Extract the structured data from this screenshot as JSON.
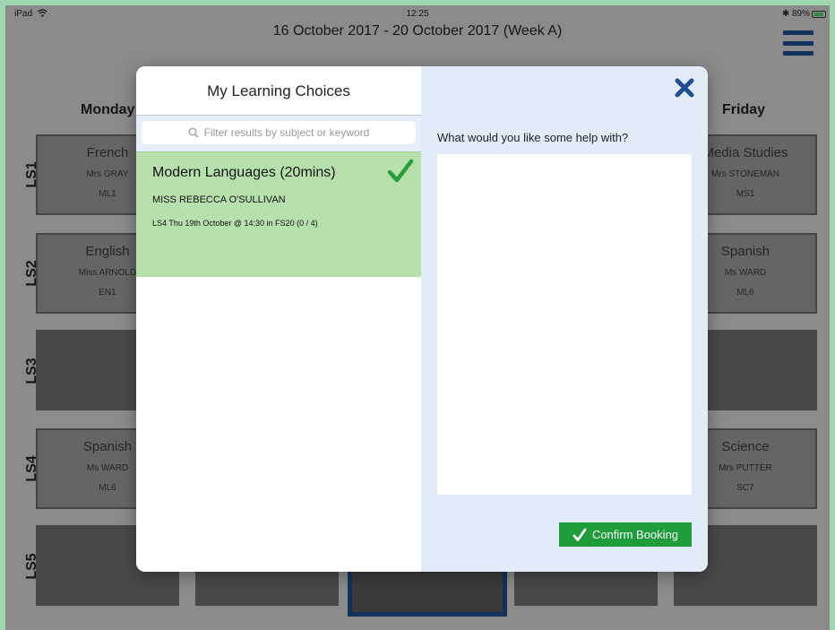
{
  "status_bar": {
    "device": "iPad",
    "time": "12:25",
    "battery_text": "89%",
    "battery_level": 0.89
  },
  "header": {
    "week_title": "16 October 2017 - 20 October 2017 (Week A)"
  },
  "days": [
    "Monday",
    "Friday"
  ],
  "rows": [
    "LS1",
    "LS2",
    "LS3",
    "LS4",
    "LS5"
  ],
  "monday_cells": [
    {
      "subject": "French",
      "teacher": "Mrs GRAY",
      "room": "ML1"
    },
    {
      "subject": "English",
      "teacher": "Miss ARNOLD",
      "room": "EN1"
    },
    {
      "subject": "",
      "teacher": "",
      "room": ""
    },
    {
      "subject": "Spanish",
      "teacher": "Ms WARD",
      "room": "ML6"
    },
    {
      "subject": "",
      "teacher": "",
      "room": ""
    }
  ],
  "friday_cells": [
    {
      "subject": "Media Studies",
      "teacher": "Mrs STONEMAN",
      "room": "MS1"
    },
    {
      "subject": "Spanish",
      "teacher": "Ms WARD",
      "room": "ML6"
    },
    {
      "subject": "",
      "teacher": "",
      "room": ""
    },
    {
      "subject": "Science",
      "teacher": "Mrs PUTTER",
      "room": "SC7"
    },
    {
      "subject": "",
      "teacher": "",
      "room": ""
    }
  ],
  "modal": {
    "title": "My Learning Choices",
    "search_placeholder": "Filter results by subject or keyword",
    "result": {
      "title": "Modern Languages (20mins)",
      "teacher": "MISS REBECCA O'SULLIVAN",
      "detail": "LS4 Thu 19th October @ 14:30 in FS20 (0 / 4)"
    },
    "help_label": "What would you like some help with?",
    "help_value": "",
    "confirm_label": "Confirm Booking"
  },
  "colors": {
    "accent": "#1d4f91",
    "confirm": "#1f9d3a",
    "selected_result": "#b6e1ad",
    "check": "#2a9c3a"
  },
  "icons": [
    "wifi-icon",
    "bluetooth-icon",
    "battery-icon",
    "menu-icon",
    "search-icon",
    "checkmark-icon",
    "close-icon"
  ]
}
